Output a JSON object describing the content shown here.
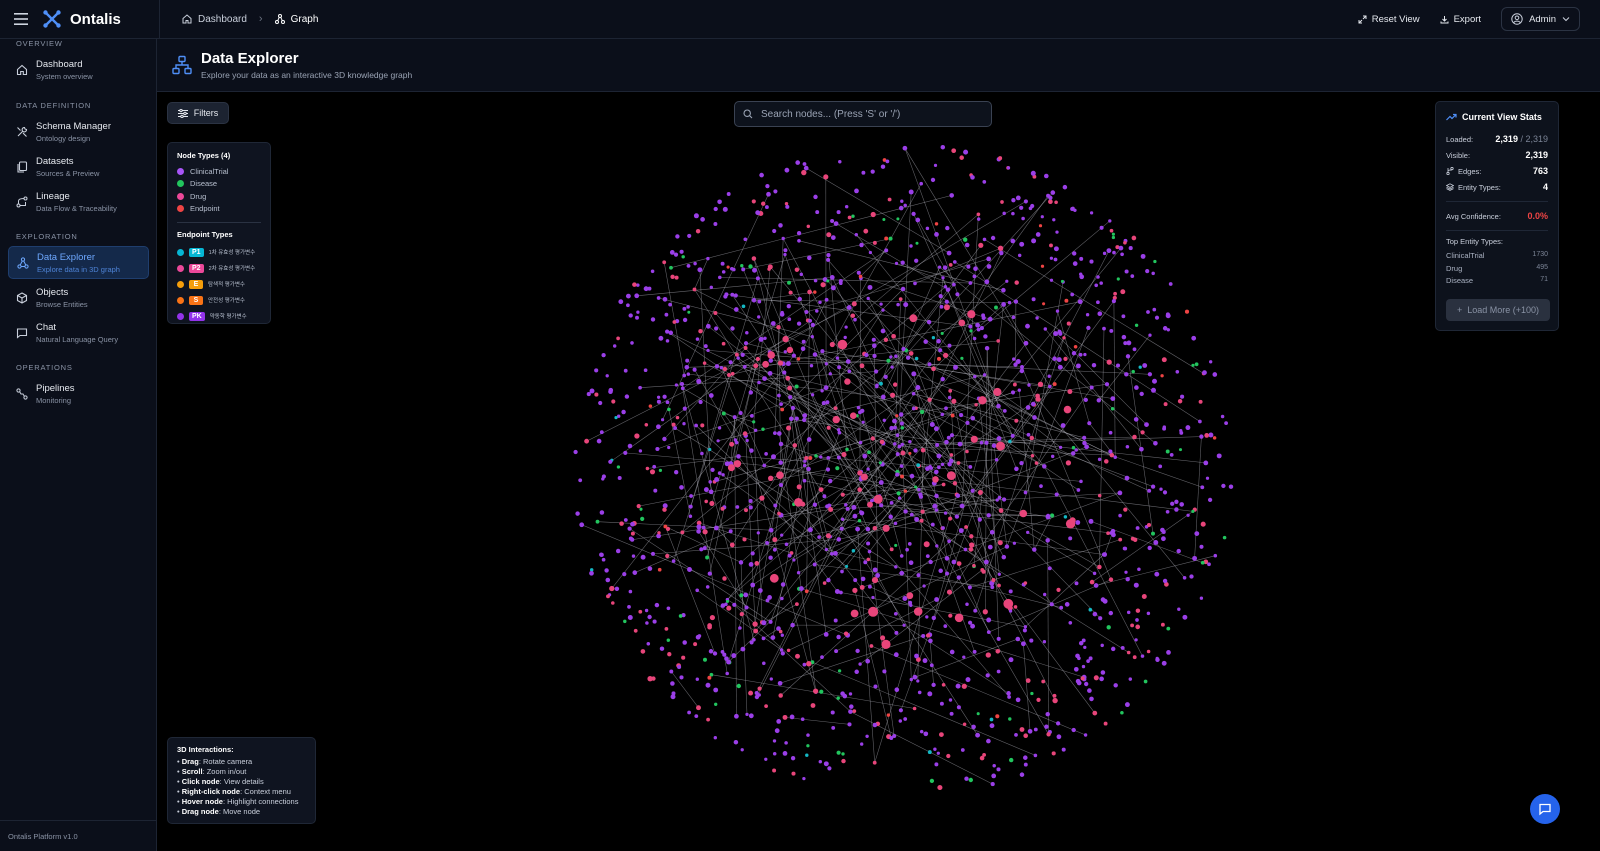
{
  "app": {
    "name": "Ontalis",
    "version": "Ontalis Platform v1.0"
  },
  "breadcrumb": [
    {
      "label": "Dashboard",
      "icon": "home-icon"
    },
    {
      "label": "Graph",
      "icon": "graph-icon"
    }
  ],
  "top_actions": {
    "reset": "Reset View",
    "export": "Export",
    "user": "Admin"
  },
  "sidebar": {
    "sections": [
      {
        "title": "OVERVIEW",
        "items": [
          {
            "label": "Dashboard",
            "sub": "System overview",
            "icon": "home-icon"
          }
        ]
      },
      {
        "title": "DATA DEFINITION",
        "items": [
          {
            "label": "Schema Manager",
            "sub": "Ontology design",
            "icon": "tools-icon"
          },
          {
            "label": "Datasets",
            "sub": "Sources & Preview",
            "icon": "files-icon"
          },
          {
            "label": "Lineage",
            "sub": "Data Flow & Traceability",
            "icon": "lineage-icon"
          }
        ]
      },
      {
        "title": "EXPLORATION",
        "items": [
          {
            "label": "Data Explorer",
            "sub": "Explore data in 3D graph",
            "icon": "network-icon",
            "active": true
          },
          {
            "label": "Objects",
            "sub": "Browse Entities",
            "icon": "cube-icon"
          },
          {
            "label": "Chat",
            "sub": "Natural Language Query",
            "icon": "chat-icon"
          }
        ]
      },
      {
        "title": "OPERATIONS",
        "items": [
          {
            "label": "Pipelines",
            "sub": "Monitoring",
            "icon": "pipeline-icon"
          }
        ]
      }
    ]
  },
  "page": {
    "title": "Data Explorer",
    "subtitle": "Explore your data as an interactive 3D knowledge graph"
  },
  "filters_label": "Filters",
  "search": {
    "placeholder": "Search nodes... (Press 'S' or '/')"
  },
  "legend": {
    "node_types_title": "Node Types (4)",
    "node_types": [
      {
        "label": "ClinicalTrial",
        "color": "#a855f7"
      },
      {
        "label": "Disease",
        "color": "#22c55e"
      },
      {
        "label": "Drug",
        "color": "#ec4899"
      },
      {
        "label": "Endpoint",
        "color": "#ef4444"
      }
    ],
    "endpoint_types_title": "Endpoint Types",
    "endpoint_types": [
      {
        "badge": "P1",
        "label": "1차 유효성 평가변수",
        "color": "#06b6d4"
      },
      {
        "badge": "P2",
        "label": "2차 유효성 평가변수",
        "color": "#ec4899"
      },
      {
        "badge": "E",
        "label": "탐색적 평가변수",
        "color": "#f59e0b"
      },
      {
        "badge": "S",
        "label": "안전성 평가변수",
        "color": "#f97316"
      },
      {
        "badge": "PK",
        "label": "약동학 평가변수",
        "color": "#9333ea"
      }
    ]
  },
  "stats": {
    "title": "Current View Stats",
    "loaded_label": "Loaded:",
    "loaded": "2,319",
    "loaded_total": "/ 2,319",
    "visible_label": "Visible:",
    "visible": "2,319",
    "edges_label": "Edges:",
    "edges": "763",
    "entity_types_label": "Entity Types:",
    "entity_types": "4",
    "avg_conf_label": "Avg Confidence:",
    "avg_conf": "0.0%",
    "top_title": "Top Entity Types:",
    "top": [
      {
        "label": "ClinicalTrial",
        "count": "1730"
      },
      {
        "label": "Drug",
        "count": "495"
      },
      {
        "label": "Disease",
        "count": "71"
      }
    ],
    "load_more": "Load More (+100)"
  },
  "interactions": {
    "title": "3D Interactions:",
    "items": [
      {
        "key": "Drag",
        "desc": ": Rotate camera"
      },
      {
        "key": "Scroll",
        "desc": ": Zoom in/out"
      },
      {
        "key": "Click node",
        "desc": ": View details"
      },
      {
        "key": "Right-click node",
        "desc": ": Context menu"
      },
      {
        "key": "Hover node",
        "desc": ": Highlight connections"
      },
      {
        "key": "Drag node",
        "desc": ": Move node"
      }
    ]
  },
  "graph": {
    "node_colors": {
      "ClinicalTrial": "#9b3fe8",
      "Drug": "#e8457a",
      "Disease": "#22c55e",
      "Endpoint": "#ef4444",
      "Other": "#14b8c4"
    }
  }
}
